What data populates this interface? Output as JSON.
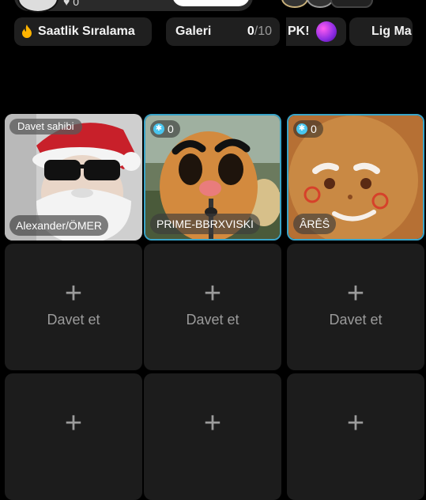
{
  "header": {
    "likes_count": "0"
  },
  "chips": {
    "ranking_label": "Saatlik Sıralama",
    "ranking_icon": "fire-icon",
    "gallery_label": "Galeri",
    "gallery_current": "0",
    "gallery_total": "/10",
    "pk_label": "PK!",
    "league_label": "Lig Ma"
  },
  "guests": [
    {
      "name": "Alexander/ÖMER",
      "badge": "Davet sahibi",
      "avatar": "santa-sunglasses"
    },
    {
      "name": "PRIME-BBRXVISKI",
      "gift_count": "0",
      "avatar": "potato-face"
    },
    {
      "name": "ÂRÊŜ",
      "gift_count": "0",
      "avatar": "gingerbread-face"
    }
  ],
  "empty_slots": {
    "plus_symbol": "+",
    "invite_label": "Davet et"
  },
  "colors": {
    "background": "#000000",
    "tile_empty": "#1c1c1c",
    "active_border": "#3aa4c8",
    "coin": "#49c6ef",
    "fire": "#ffb400"
  }
}
